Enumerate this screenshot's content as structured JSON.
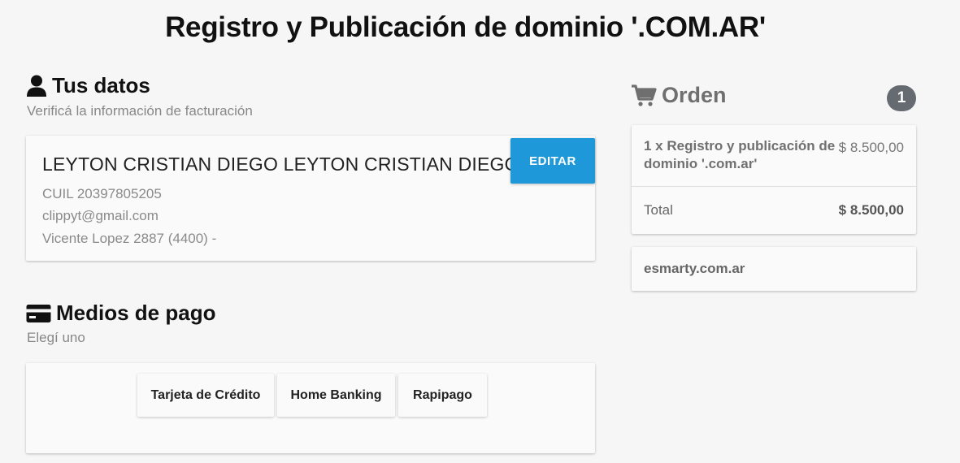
{
  "page": {
    "title": "Registro y Publicación de dominio '.COM.AR'"
  },
  "billing": {
    "heading": "Tus datos",
    "subheading": "Verificá la información de facturación",
    "name": "LEYTON CRISTIAN DIEGO LEYTON CRISTIAN DIEGO",
    "cuil": "CUIL 20397805205",
    "email": "clippyt@gmail.com",
    "address": "Vicente Lopez 2887 (4400) -",
    "edit_label": "EDITAR",
    "user_icon": "user-icon"
  },
  "payment": {
    "heading": "Medios de pago",
    "subheading": "Elegí uno",
    "card_icon": "credit-card-icon",
    "methods": [
      "Tarjeta de Crédito",
      "Home Banking",
      "Rapipago"
    ]
  },
  "order": {
    "heading": "Orden",
    "cart_icon": "cart-icon",
    "count": "1",
    "item_label": "1 x Registro y publicación de dominio '.com.ar'",
    "item_price": "$ 8.500,00",
    "total_label": "Total",
    "total_value": "$ 8.500,00",
    "domain": "esmarty.com.ar"
  },
  "colors": {
    "accent": "#1e98d8",
    "background": "#f6f6f6",
    "badge": "#666b72"
  }
}
